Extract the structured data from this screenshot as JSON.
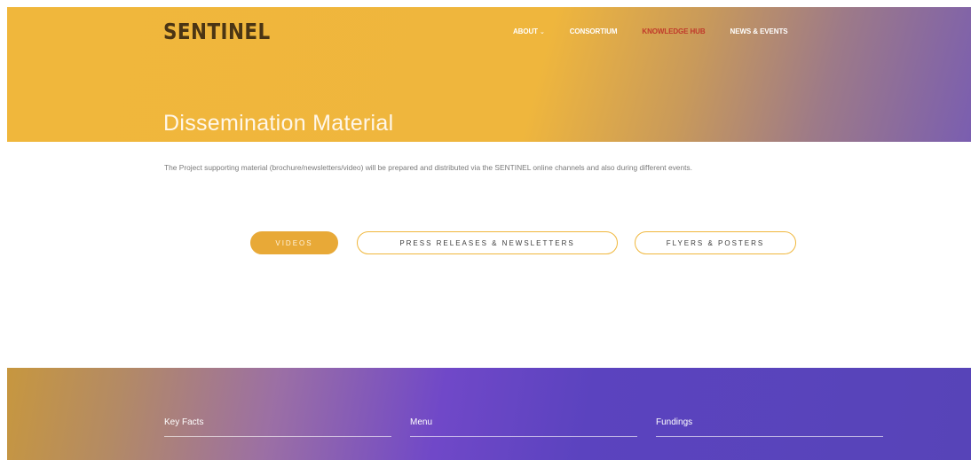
{
  "header": {
    "logo_text": "SENTINEL",
    "nav": [
      {
        "label": "ABOUT",
        "has_caret": true,
        "active": false
      },
      {
        "label": "CONSORTIUM",
        "active": false
      },
      {
        "label": "KNOWLEDGE HUB",
        "active": true
      },
      {
        "label": "NEWS & EVENTS",
        "active": false
      }
    ],
    "caret_glyph": "⌄"
  },
  "page": {
    "title": "Dissemination Material",
    "intro": "The Project supporting material (brochure/newsletters/video) will be prepared and distributed via the SENTINEL online channels and also during different events."
  },
  "filters": {
    "videos": "VIDEOS",
    "press": "PRESS RELEASES & NEWSLETTERS",
    "flyers": "FLYERS & POSTERS",
    "active": "videos"
  },
  "footer": {
    "columns": [
      "Key Facts",
      "Menu",
      "Fundings"
    ]
  },
  "colors": {
    "brand_yellow": "#f0b73c",
    "brand_purple": "#5744b8",
    "active_nav": "#c0392b"
  }
}
